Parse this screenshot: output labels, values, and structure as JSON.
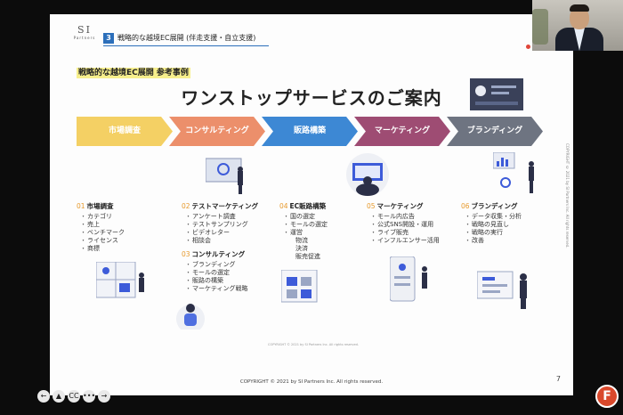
{
  "slide": {
    "logo": {
      "big": "SI",
      "small": "Partners"
    },
    "section": {
      "number": "3",
      "title": "戦略的な越境EC展開 (伴走支援・自立支援)"
    },
    "subtitle": "戦略的な越境EC展開 参考事例",
    "title": "ワンストップサービスのご案内",
    "steps": [
      {
        "label": "市場調査",
        "color": "#f4d064"
      },
      {
        "label": "コンサルティング",
        "color": "#ec8f6b"
      },
      {
        "label": "販路構築",
        "color": "#3d88d4"
      },
      {
        "label": "マーケティング",
        "color": "#9e4c73"
      },
      {
        "label": "ブランディング",
        "color": "#6e7481"
      }
    ],
    "columns": [
      {
        "num": "01",
        "head": "市場調査",
        "items": [
          "カテゴリ",
          "売上",
          "ベンチマーク",
          "ライセンス",
          "商標"
        ]
      },
      {
        "num": "02",
        "head": "テストマーケティング",
        "items": [
          "アンケート調査",
          "テストサンプリング",
          "ビデオレター",
          "相談会"
        ],
        "num2": "03",
        "head2": "コンサルティング",
        "items2": [
          "ブランディング",
          "モールの選定",
          "販路の構築",
          "マーケティング戦略"
        ]
      },
      {
        "num": "04",
        "head": "EC販路構築",
        "items": [
          "国の選定",
          "モールの選定",
          "運営"
        ],
        "subitems": [
          "物流",
          "決済",
          "販売促進"
        ]
      },
      {
        "num": "05",
        "head": "マーケティング",
        "items": [
          "モール内広告",
          "公式SNS開設・運用",
          "ライブ販売",
          "インフルエンサー活用"
        ]
      },
      {
        "num": "06",
        "head": "ブランディング",
        "items": [
          "データ収集・分析",
          "戦略の見直し",
          "戦略の実行",
          "改善"
        ]
      }
    ],
    "mini_copyright": "COPYRIGHT © 2021 by SI Partners Inc. All rights reserved.",
    "side_copyright": "COPYRIGHT © 2021 by SI Partners Inc. All rights reserved.",
    "footer": "COPYRIGHT © 2021 by SI Partners Inc. All rights reserved.",
    "page_number": "7"
  },
  "controls": [
    {
      "name": "back-arrow-icon",
      "glyph": "←"
    },
    {
      "name": "pointer-icon",
      "glyph": "▲"
    },
    {
      "name": "captions-icon",
      "glyph": "CC"
    },
    {
      "name": "more-icon",
      "glyph": "•••"
    },
    {
      "name": "forward-arrow-icon",
      "glyph": "→"
    }
  ],
  "brand_icon": {
    "glyph": "F",
    "color": "#d9482b"
  }
}
